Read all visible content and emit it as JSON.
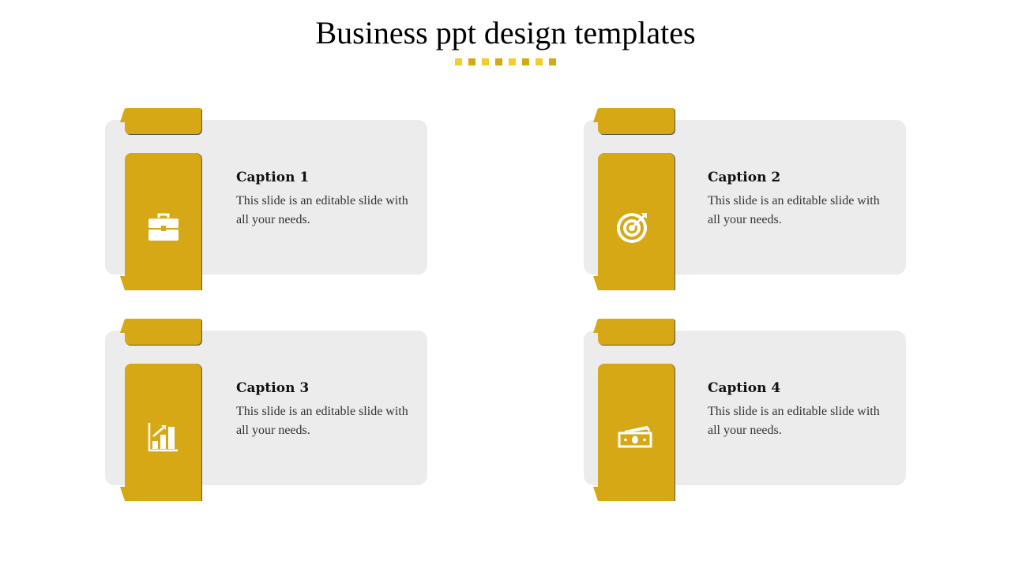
{
  "slide": {
    "title": "Business ppt design templates",
    "accent_colors": [
      "#f2cd2d",
      "#d6a815"
    ],
    "dot_count": 8
  },
  "cards": [
    {
      "caption": "Caption 1",
      "text": "This slide is an editable slide with all your needs.",
      "icon": "briefcase-icon"
    },
    {
      "caption": "Caption 2",
      "text": "This slide is an editable slide with all your needs.",
      "icon": "target-icon"
    },
    {
      "caption": "Caption 3",
      "text": "This slide is an editable slide with all your needs.",
      "icon": "growth-chart-icon"
    },
    {
      "caption": "Caption 4",
      "text": "This slide is an editable slide with all your needs.",
      "icon": "money-icon"
    }
  ]
}
